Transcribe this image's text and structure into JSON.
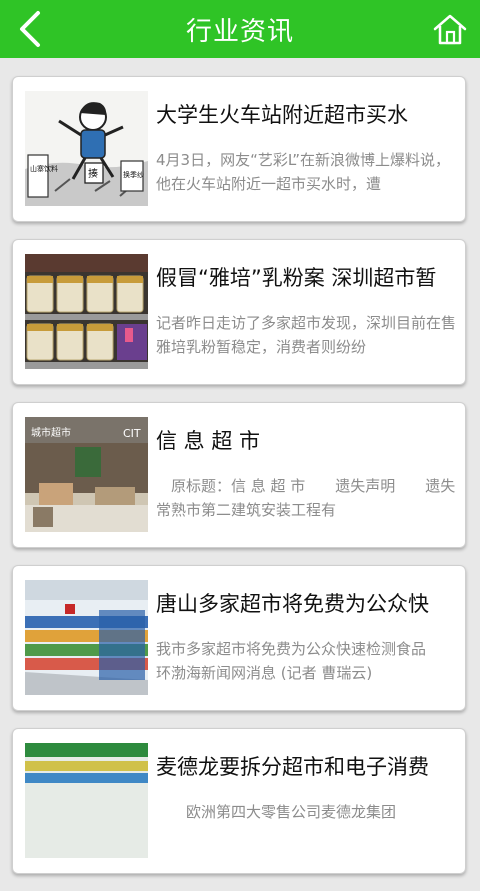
{
  "header": {
    "title": "行业资讯",
    "back_icon": "chevron-left-icon",
    "home_icon": "home-icon",
    "background": "#2fc426"
  },
  "articles": [
    {
      "title": "大学生火车站附近超市买水",
      "summary": "4月3日，网友“艺彩L”在新浪微博上爆料说，他在火车站附近一超市买水时，遭",
      "thumb_text": [
        "山寨饮料",
        "揍",
        "换季纱"
      ]
    },
    {
      "title": "假冒“雅培”乳粉案 深圳超市暂",
      "summary": "记者昨日走访了多家超市发现，深圳目前在售雅培乳粉暂稳定，消费者则纷纷"
    },
    {
      "title": "信 息 超 市",
      "summary": "　原标题：信 息 超 市　　遗失声明　　遗失常熟市第二建筑安装工程有",
      "thumb_text": [
        "城市超市",
        "CIT"
      ]
    },
    {
      "title": "唐山多家超市将免费为公众快",
      "summary": "我市多家超市将免费为公众快速检测食品　　环渤海新闻网消息 (记者 曹瑞云)"
    },
    {
      "title": "麦德龙要拆分超市和电子消费",
      "summary": "　　欧洲第四大零售公司麦德龙集团"
    }
  ]
}
